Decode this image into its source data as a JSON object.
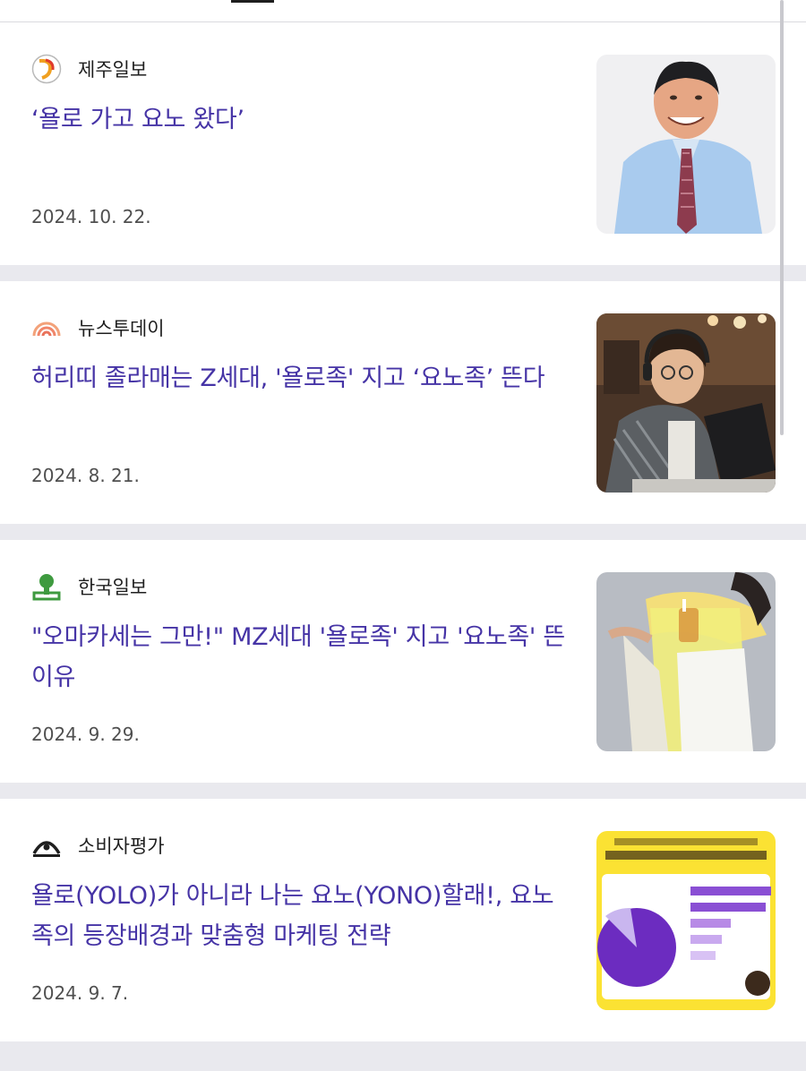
{
  "articles": [
    {
      "press": "제주일보",
      "logo_icon": "jeju-ilbo-logo-icon",
      "headline": "‘욜로 가고 요노 왔다’",
      "date": "2024. 10. 22.",
      "thumb_icon": "man-portrait-photo"
    },
    {
      "press": "뉴스투데이",
      "logo_icon": "newstoday-rainbow-logo-icon",
      "headline": "허리띠 졸라매는 Z세대, '욜로족' 지고 ‘요노족’ 뜬다",
      "date": "2024. 8. 21.",
      "thumb_icon": "student-laptop-photo"
    },
    {
      "press": "한국일보",
      "logo_icon": "hankook-ilbo-logo-icon",
      "headline": "\"오마카세는 그만!\" MZ세대 '욜로족' 지고 '요노족' 뜬 이유",
      "date": "2024. 9. 29.",
      "thumb_icon": "woman-coffee-photo"
    },
    {
      "press": "소비자평가",
      "logo_icon": "consumer-eval-logo-icon",
      "headline": "욜로(YOLO)가 아니라 나는 요노(YONO)할래!, 요노족의 등장배경과 맞춤형 마케팅 전략",
      "date": "2024. 9. 7.",
      "thumb_icon": "yono-infographic-image"
    }
  ],
  "colors": {
    "headline": "#4634a6",
    "separator": "#e9e9ee",
    "date": "#4f4f4f"
  }
}
